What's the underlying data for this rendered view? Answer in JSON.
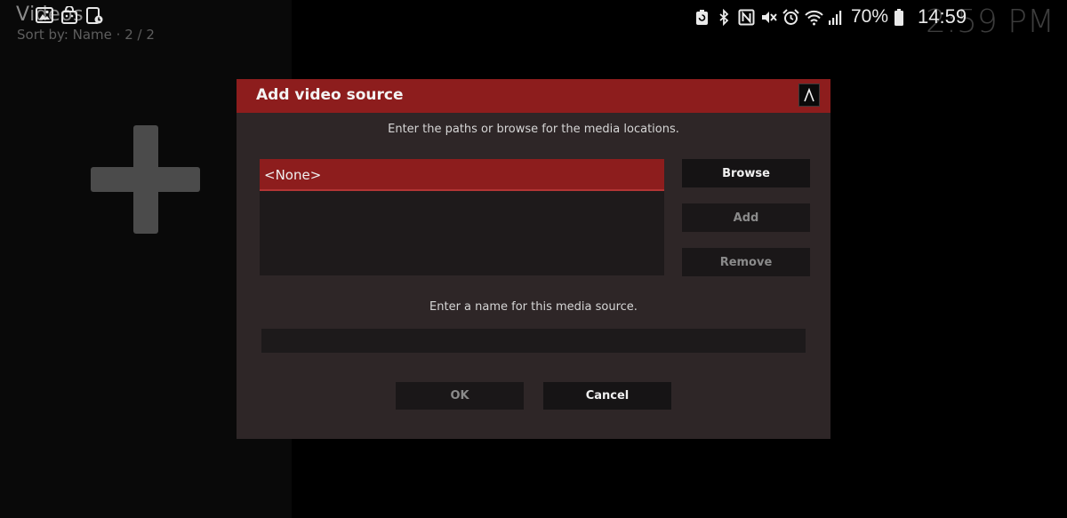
{
  "background": {
    "title": "Videos",
    "sort_info": "Sort by: Name  ·  2 / 2",
    "clock": "2:59 PM"
  },
  "status_bar": {
    "left_icons": [
      "gallery-icon",
      "shopping-bag-icon",
      "screenshot-icon"
    ],
    "right_icons": [
      "battery-saver-icon",
      "bluetooth-icon",
      "nfc-icon",
      "mute-icon",
      "alarm-icon",
      "wifi-icon",
      "signal-icon"
    ],
    "battery_percent": "70%",
    "time": "14:59"
  },
  "dialog": {
    "title": "Add video source",
    "paths_instruction": "Enter the paths or browse for the media locations.",
    "paths": [
      "<None>"
    ],
    "buttons": {
      "browse": "Browse",
      "add": "Add",
      "remove": "Remove",
      "ok": "OK",
      "cancel": "Cancel"
    },
    "name_instruction": "Enter a name for this media source.",
    "name_value": ""
  },
  "colors": {
    "accent": "#8d1d1d",
    "dialog_bg": "#2e2627",
    "button_bg": "#161415"
  }
}
